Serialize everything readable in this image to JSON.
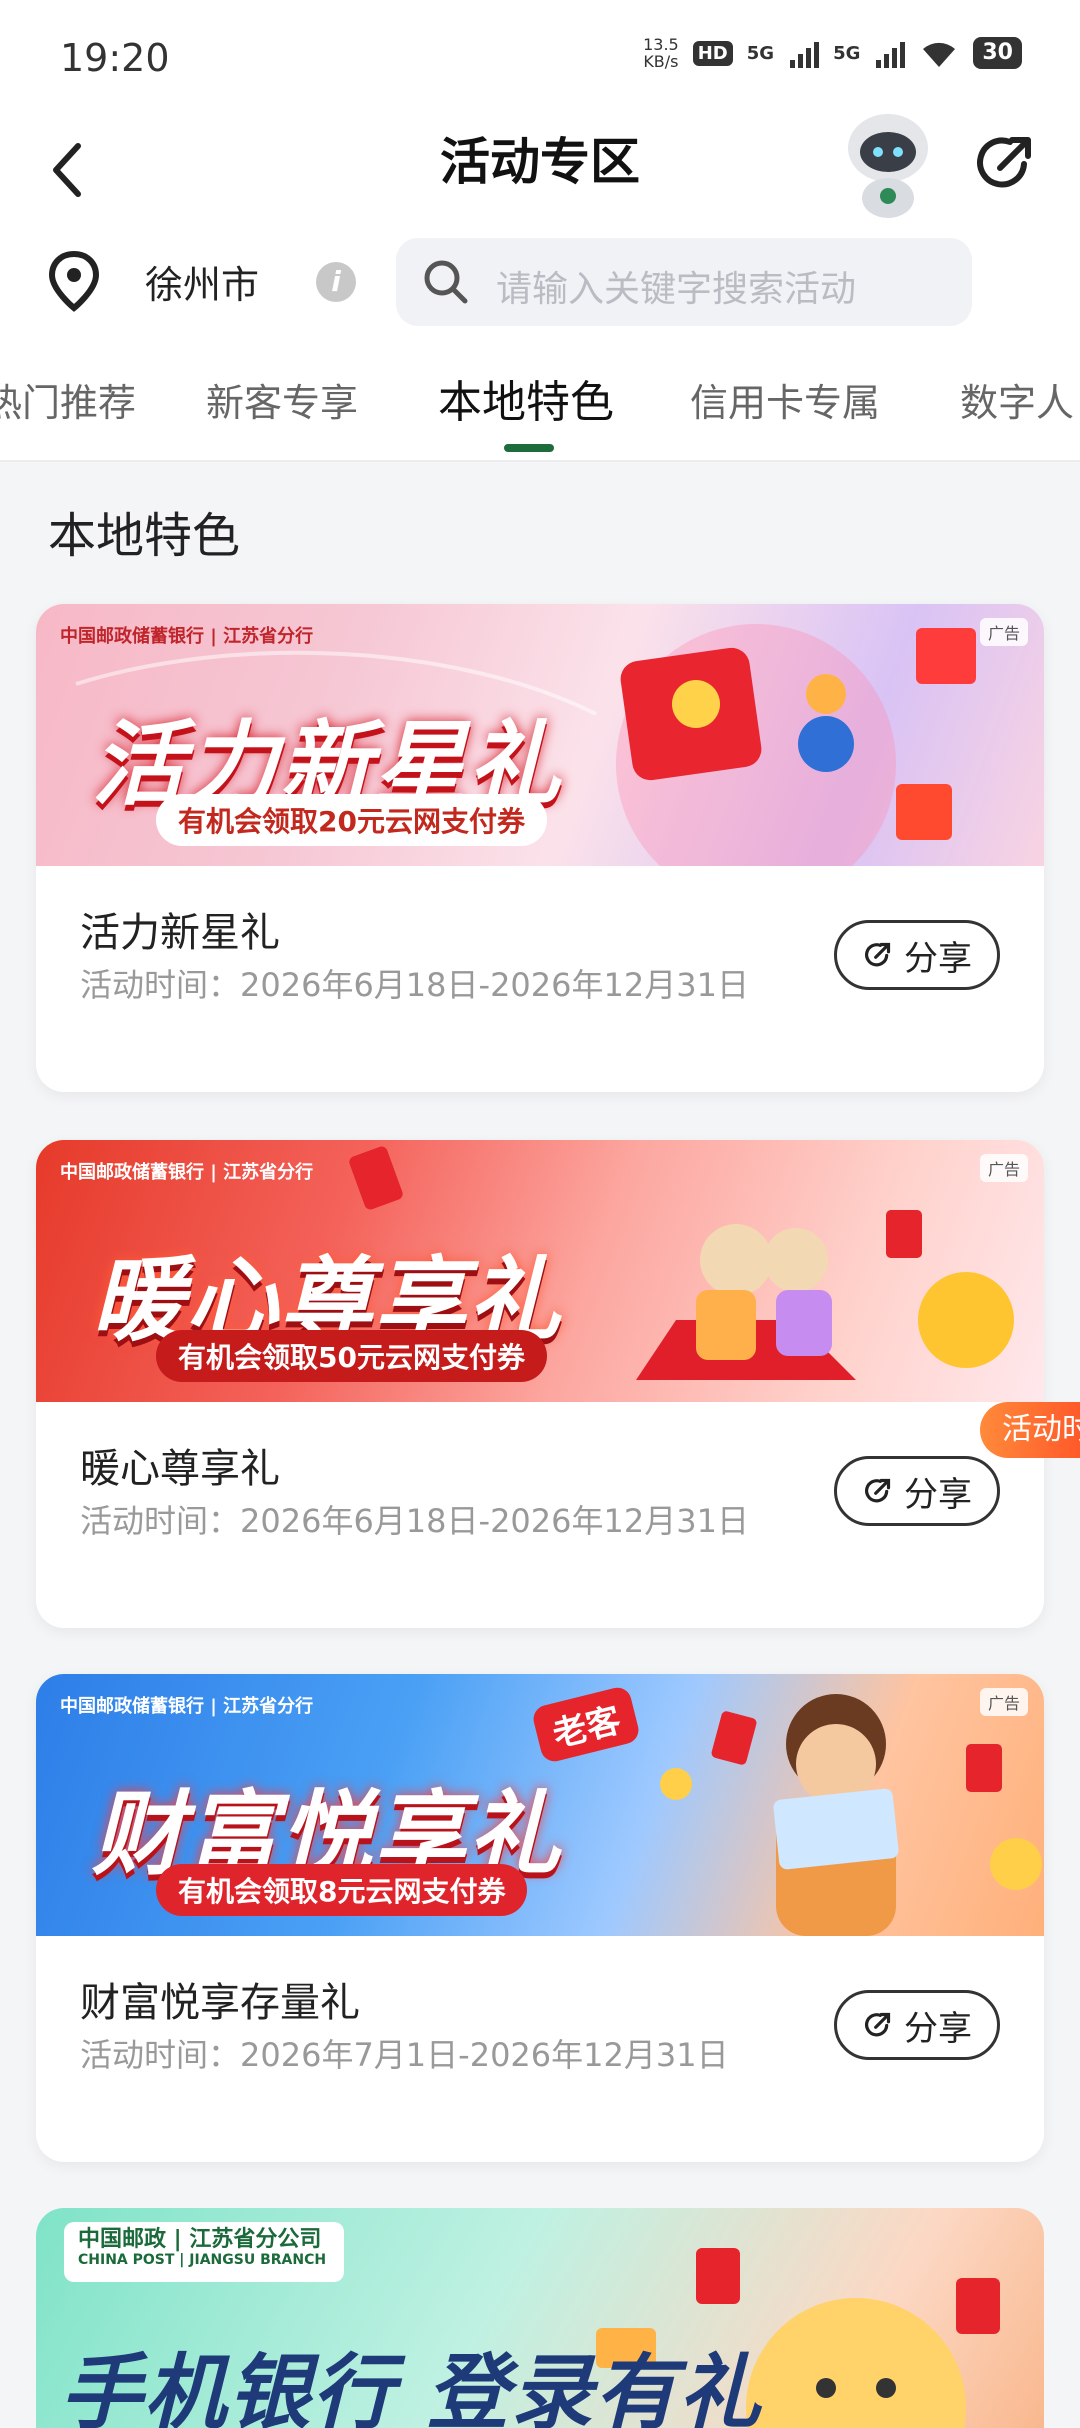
{
  "status": {
    "time": "19:20",
    "net_speed": "13.5",
    "net_unit": "KB/s",
    "hd": "HD",
    "sig1": "5G",
    "sig2": "5G",
    "battery": "30"
  },
  "header": {
    "title": "活动专区"
  },
  "location": {
    "city": "徐州市"
  },
  "search": {
    "placeholder": "请输入关键字搜索活动"
  },
  "tabs": [
    {
      "label": "热门推荐"
    },
    {
      "label": "新客专享"
    },
    {
      "label": "本地特色"
    },
    {
      "label": "信用卡专属"
    },
    {
      "label": "数字人"
    }
  ],
  "active_tab": "本地特色",
  "section": {
    "title": "本地特色"
  },
  "cards": [
    {
      "banner_title": "活力新星礼",
      "banner_sub": "有机会领取20元云网支付券",
      "bank": "中国邮政储蓄银行 | 江苏省分行",
      "ad": "广告",
      "name": "活力新星礼",
      "time": "活动时间：2026年6月18日-2026年12月31日",
      "share": "分享"
    },
    {
      "banner_title": "暖心尊享礼",
      "banner_sub": "有机会领取50元云网支付券",
      "bank": "中国邮政储蓄银行 | 江苏省分行",
      "ad": "广告",
      "name": "暖心尊享礼",
      "time": "活动时间：2026年6月18日-2026年12月31日",
      "share": "分享"
    },
    {
      "banner_title": "财富悦享礼",
      "banner_sub": "有机会领取8元云网支付券",
      "bank": "中国邮政储蓄银行 | 江苏省分行",
      "ad": "广告",
      "name": "财富悦享存量礼",
      "time": "活动时间：2026年7月1日-2026年12月31日",
      "share": "分享",
      "badge": "老客"
    }
  ],
  "floating_tag": "活动时",
  "card4": {
    "logo_line1": "中国邮政 | 江苏省分公司",
    "logo_line2": "CHINA POST | JIANGSU BRANCH",
    "title": "手机银行 登录有礼"
  }
}
